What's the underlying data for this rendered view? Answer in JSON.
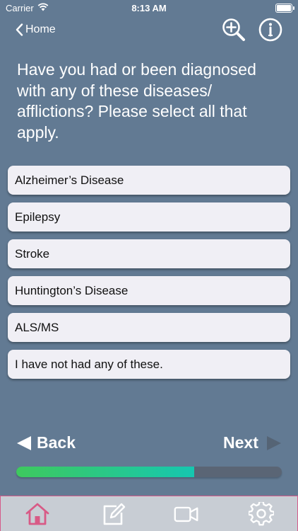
{
  "status_bar": {
    "carrier": "Carrier",
    "time": "8:13 AM"
  },
  "nav": {
    "back_label": "Home"
  },
  "question": "Have you had or been diagnosed with any of these diseases/ afflictions? Please select all that apply.",
  "options": [
    "Alzheimer’s Disease",
    "Epilepsy",
    "Stroke",
    "Huntington’s Disease",
    "ALS/MS",
    "I have not had any of these."
  ],
  "footer": {
    "back_label": "Back",
    "next_label": "Next"
  },
  "progress": {
    "value": 0.67
  },
  "tabs": [
    "home-icon",
    "edit-icon",
    "video-icon",
    "settings-icon"
  ],
  "colors": {
    "background": "#627a93",
    "option_bg": "#f0eff5",
    "progress_start": "#3ec95e",
    "progress_end": "#16c7b0",
    "home_active": "#d85a86",
    "tab_bar": "#c8cdd4"
  }
}
